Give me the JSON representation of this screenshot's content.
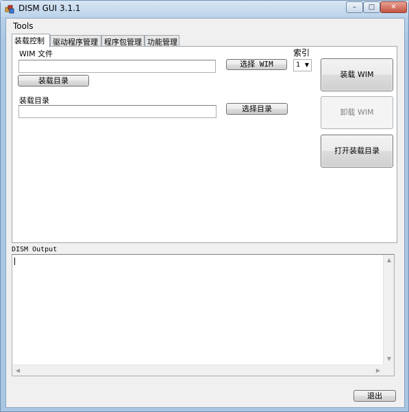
{
  "window": {
    "title": "DISM GUI 3.1.1",
    "controls": {
      "minimize": "–",
      "maximize": "□",
      "close": "✕"
    }
  },
  "menu": {
    "items": [
      {
        "label": "Tools"
      }
    ]
  },
  "tabs": [
    {
      "label": "装载控制",
      "active": true
    },
    {
      "label": "驱动程序管理",
      "active": false
    },
    {
      "label": "程序包管理",
      "active": false
    },
    {
      "label": "功能管理",
      "active": false
    }
  ],
  "mount_panel": {
    "wim_file_label": "WIM 文件",
    "wim_file_value": "",
    "select_wim_button": "选择 WIM",
    "mount_dir_button": "装载目录",
    "mount_dir_label": "装载目录",
    "mount_dir_value": "",
    "select_dir_button": "选择目录",
    "index_label": "索引",
    "index_value": "1",
    "mount_wim_button": "装载 WIM",
    "unmount_wim_button": "卸载 WIM",
    "open_mount_dir_button": "打开装载目录"
  },
  "output": {
    "label": "DISM Output",
    "content": ""
  },
  "footer": {
    "exit_button": "退出"
  },
  "colors": {
    "titlebar": "#bcd3ea",
    "client_bg": "#f0f0f0",
    "panel_bg": "#ffffff",
    "button_border": "#707070",
    "disabled_text": "#838383",
    "close_button": "#c45341"
  },
  "icons": {
    "app": "app-window-icon",
    "scroll_up": "arrow-up-icon",
    "scroll_down": "arrow-down-icon",
    "scroll_left": "arrow-left-icon",
    "scroll_right": "arrow-right-icon",
    "combo_arrow": "chevron-down-icon"
  }
}
